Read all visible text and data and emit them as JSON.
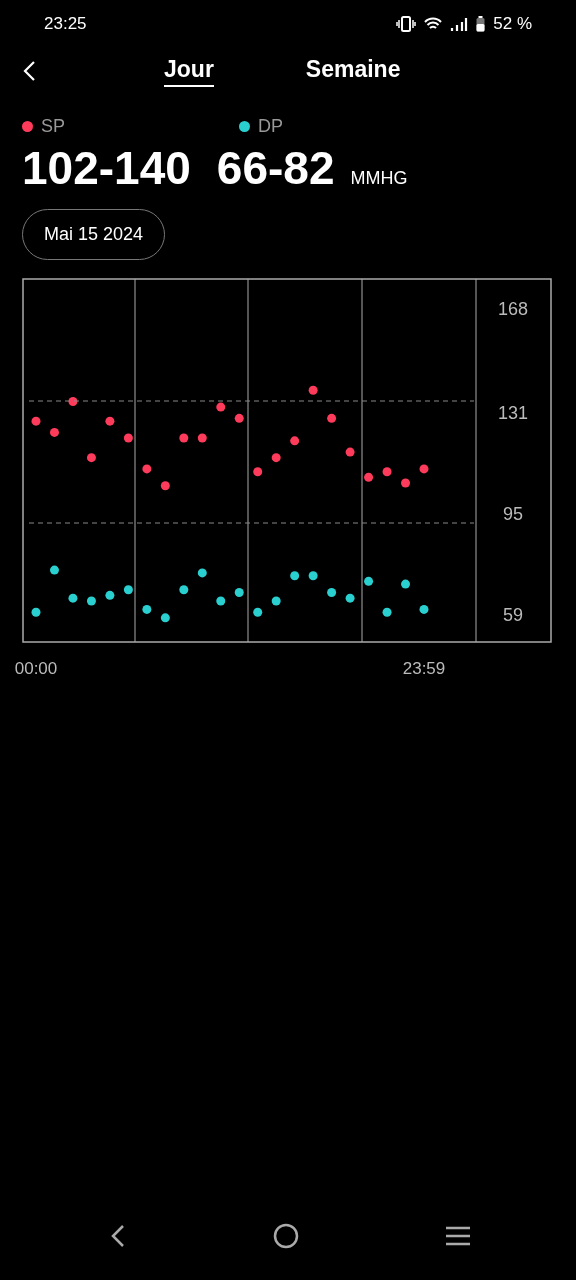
{
  "status_bar": {
    "time": "23:25",
    "battery": "52 %"
  },
  "tabs": [
    {
      "label": "Jour",
      "selected": true
    },
    {
      "label": "Semaine",
      "selected": false
    }
  ],
  "readings": [
    "102-140",
    "66-82"
  ],
  "unit": "MMHG",
  "date": "Mai 15 2024",
  "chart": {
    "chart_data": {
      "type": "scatter",
      "categories": [
        "00:00",
        null,
        null,
        null,
        null,
        null,
        null,
        null,
        null,
        null,
        null,
        null,
        null,
        null,
        null,
        null,
        null,
        null,
        null,
        null,
        null,
        "23:59"
      ],
      "ylim": [
        49.4,
        178.6
      ],
      "yticks": [
        59,
        95,
        131,
        168
      ],
      "series": [
        {
          "name": "SP",
          "color": "#ff3b5c",
          "values": [
            128,
            124,
            135,
            115,
            128,
            122,
            111,
            105,
            122,
            122,
            133,
            129,
            110,
            115,
            121,
            139,
            129,
            117,
            108,
            110,
            106,
            111
          ]
        },
        {
          "name": "DP",
          "color": "#2ad0d0",
          "values": [
            60,
            75,
            65,
            64,
            66,
            68,
            61,
            58,
            68,
            74,
            64,
            67,
            60,
            64,
            73,
            73,
            67,
            65,
            71,
            60,
            70,
            61
          ]
        }
      ]
    }
  }
}
